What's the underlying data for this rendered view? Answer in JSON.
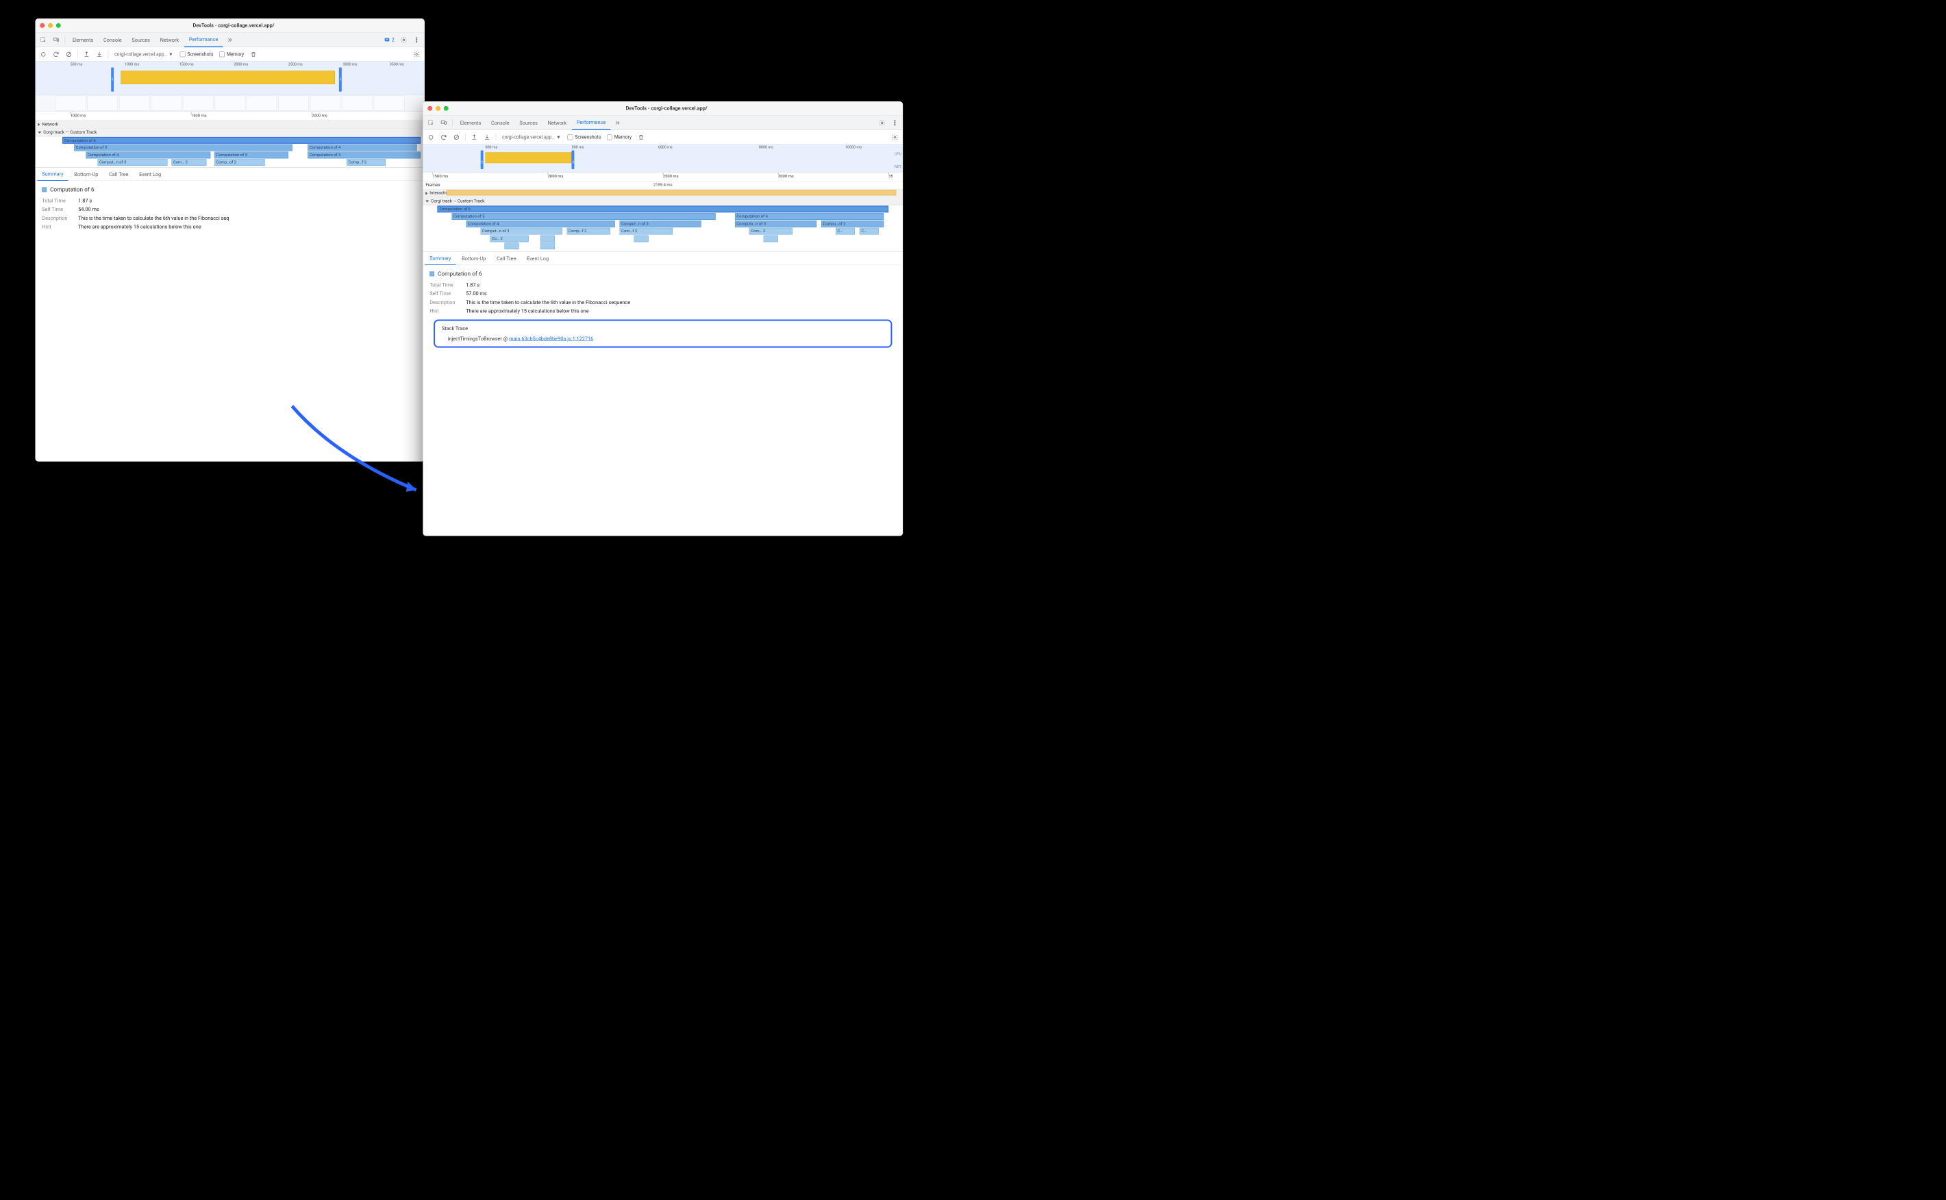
{
  "colors": {
    "accent": "#1a73e8",
    "flame": "#7db3e7",
    "highlight": "#2962ff"
  },
  "window_left": {
    "title": "DevTools - corgi-collage.vercel.app/",
    "main_tabs": [
      "Elements",
      "Console",
      "Sources",
      "Network",
      "Performance"
    ],
    "active_tab": "Performance",
    "issues_count": "2",
    "toolbar": {
      "url": "corgi-collage.vercel.app…",
      "screenshots_label": "Screenshots",
      "memory_label": "Memory"
    },
    "overview_ticks": [
      "500 ms",
      "1000 ms",
      "1500 ms",
      "2000 ms",
      "2500 ms",
      "3000 ms",
      "3500 ms"
    ],
    "main_ruler_ticks": [
      "1000 ms",
      "1500 ms",
      "2000 ms"
    ],
    "tracks": {
      "network": "Network",
      "custom": "Corgi track — Custom Track"
    },
    "flame": [
      {
        "row": 0,
        "label": "Computation of 6",
        "left_pct": 7,
        "width_pct": 92,
        "selected": true
      },
      {
        "row": 1,
        "label": "Computation of 5",
        "left_pct": 10,
        "width_pct": 56
      },
      {
        "row": 1,
        "label": "Computation of 4",
        "left_pct": 70,
        "width_pct": 28
      },
      {
        "row": 2,
        "label": "Computation of 4",
        "left_pct": 13,
        "width_pct": 32
      },
      {
        "row": 2,
        "label": "Computation of 3",
        "left_pct": 46,
        "width_pct": 19
      },
      {
        "row": 2,
        "label": "Computation of 3",
        "left_pct": 70,
        "width_pct": 29
      },
      {
        "row": 3,
        "label": "Comput…n of 3",
        "left_pct": 16,
        "width_pct": 18,
        "light": true
      },
      {
        "row": 3,
        "label": "Com… 2",
        "left_pct": 35,
        "width_pct": 9,
        "light": true
      },
      {
        "row": 3,
        "label": "Comp…of 2",
        "left_pct": 46,
        "width_pct": 13,
        "light": true
      },
      {
        "row": 3,
        "label": "Comp…f 2",
        "left_pct": 80,
        "width_pct": 10,
        "light": true
      }
    ],
    "detail_tabs": [
      "Summary",
      "Bottom-Up",
      "Call Tree",
      "Event Log"
    ],
    "summary": {
      "title": "Computation of 6",
      "total_time_label": "Total Time",
      "total_time": "1.87 s",
      "self_time_label": "Self Time",
      "self_time": "54.00 ms",
      "description_label": "Description",
      "description": "This is the time taken to calculate the 6th value in the Fibonacci seq",
      "hint_label": "Hint",
      "hint": "There are approximately 15 calculations below this one"
    }
  },
  "window_right": {
    "title": "DevTools - corgi-collage.vercel.app/",
    "main_tabs": [
      "Elements",
      "Console",
      "Sources",
      "Network",
      "Performance"
    ],
    "active_tab": "Performance",
    "toolbar": {
      "url": "corgi-collage.vercel.app…",
      "screenshots_label": "Screenshots",
      "memory_label": "Memory"
    },
    "overview_ticks": [
      "000 ms",
      "000 ms",
      "6000 ms",
      "8000 ms",
      "10000 ms"
    ],
    "overview_labels": {
      "cpu": "CPU",
      "net": "NET"
    },
    "main_ruler_ticks": [
      "1500 ms",
      "2000 ms",
      "2500 ms",
      "3000 ms",
      "35"
    ],
    "tracks": {
      "frames": "Frames",
      "frames_value": "2155.4 ms",
      "interactions": "Interactions",
      "custom": "Corgi track — Custom Track"
    },
    "flame": [
      {
        "row": 0,
        "label": "Computation of 6",
        "left_pct": 3,
        "width_pct": 94,
        "selected": true
      },
      {
        "row": 1,
        "label": "Computation of 5",
        "left_pct": 6,
        "width_pct": 55
      },
      {
        "row": 1,
        "label": "Computation of 4",
        "left_pct": 65,
        "width_pct": 31
      },
      {
        "row": 2,
        "label": "Computation of 4",
        "left_pct": 9,
        "width_pct": 31
      },
      {
        "row": 2,
        "label": "Comput…n of 3",
        "left_pct": 41,
        "width_pct": 17
      },
      {
        "row": 2,
        "label": "Computa…n of 3",
        "left_pct": 65,
        "width_pct": 17
      },
      {
        "row": 2,
        "label": "Compu…of 2",
        "left_pct": 83,
        "width_pct": 13
      },
      {
        "row": 3,
        "label": "Comput…n of 3",
        "left_pct": 12,
        "width_pct": 17,
        "light": true
      },
      {
        "row": 3,
        "label": "Comp…f 2",
        "left_pct": 30,
        "width_pct": 9,
        "light": true
      },
      {
        "row": 3,
        "label": "Com…f 2",
        "left_pct": 41,
        "width_pct": 11,
        "light": true
      },
      {
        "row": 3,
        "label": "Com… 2",
        "left_pct": 68,
        "width_pct": 9,
        "light": true
      },
      {
        "row": 3,
        "label": "C…",
        "left_pct": 86,
        "width_pct": 4,
        "light": true
      },
      {
        "row": 3,
        "label": "C…",
        "left_pct": 91,
        "width_pct": 4,
        "light": true
      },
      {
        "row": 4,
        "label": "Co… 2",
        "left_pct": 14,
        "width_pct": 8,
        "light": true
      },
      {
        "row": 4,
        "label": "",
        "left_pct": 24.5,
        "width_pct": 3,
        "light": true
      },
      {
        "row": 4,
        "label": "",
        "left_pct": 44,
        "width_pct": 3,
        "light": true
      },
      {
        "row": 4,
        "label": "",
        "left_pct": 71,
        "width_pct": 3,
        "light": true
      },
      {
        "row": 5,
        "label": "",
        "left_pct": 17,
        "width_pct": 3,
        "light": true
      },
      {
        "row": 5,
        "label": "",
        "left_pct": 24.5,
        "width_pct": 3,
        "light": true
      }
    ],
    "detail_tabs": [
      "Summary",
      "Bottom-Up",
      "Call Tree",
      "Event Log"
    ],
    "summary": {
      "title": "Computation of 6",
      "total_time_label": "Total Time",
      "total_time": "1.87 s",
      "self_time_label": "Self Time",
      "self_time": "57.00 ms",
      "description_label": "Description",
      "description": "This is the time taken to calculate the 6th value in the Fibonacci sequence",
      "hint_label": "Hint",
      "hint": "There are approximately 15 calculations below this one"
    },
    "stack_trace": {
      "heading": "Stack Trace",
      "fn": "injectTimingsToBrowser",
      "at": "@",
      "link": "main.63cb5c4bde8be90a.js:1:122716"
    }
  }
}
